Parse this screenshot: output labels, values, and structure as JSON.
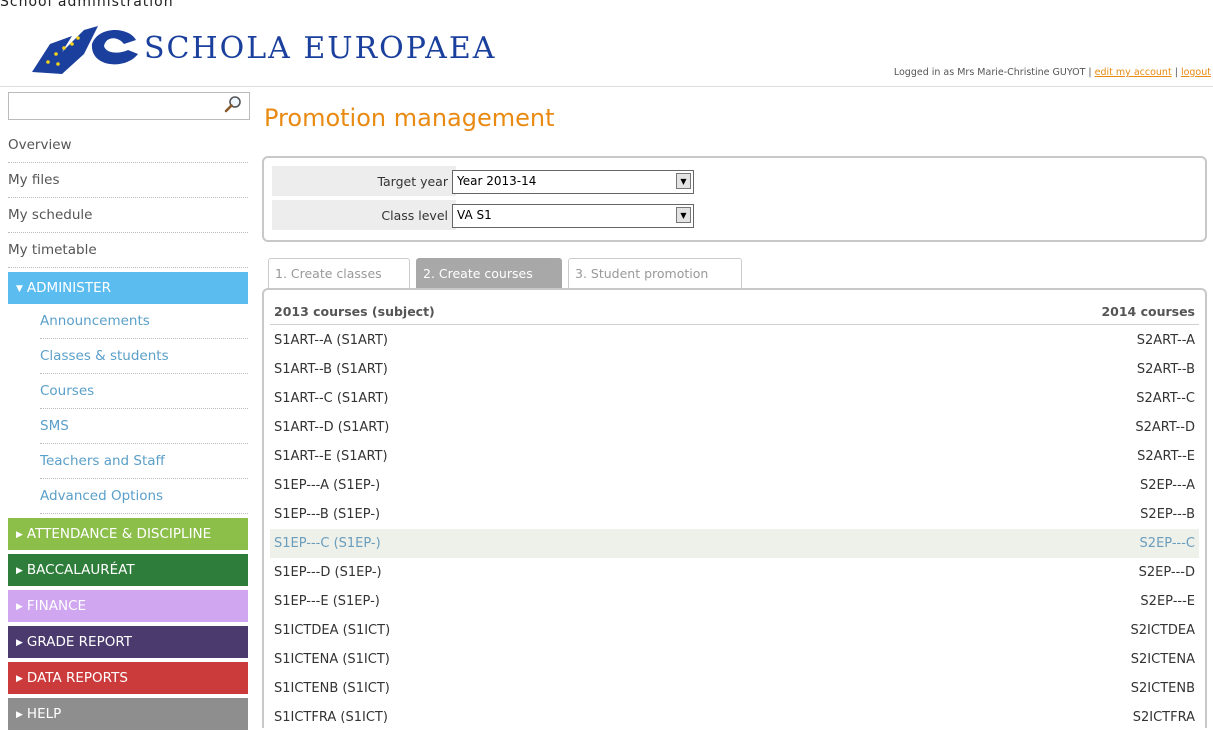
{
  "header": {
    "top_strip": "School administration",
    "logo_text": "SCHOLA EUROPAEA",
    "logged_in_text": "Logged in as Mrs Marie-Christine GUYOT |",
    "edit_account": "edit my account",
    "separator": "|",
    "logout": "logout"
  },
  "sidebar": {
    "search_placeholder": "",
    "nav": [
      "Overview",
      "My files",
      "My schedule",
      "My timetable"
    ],
    "sections": [
      {
        "label": "ADMINISTER",
        "color": "#5bbcf0",
        "expanded": true
      },
      {
        "label": "ATTENDANCE & DISCIPLINE",
        "color": "#8cbe4a"
      },
      {
        "label": "BACCALAURÉAT",
        "color": "#2e7d3a"
      },
      {
        "label": "FINANCE",
        "color": "#cfa6ef"
      },
      {
        "label": "GRADE REPORT",
        "color": "#4a3a6e"
      },
      {
        "label": "DATA REPORTS",
        "color": "#cc3b3b"
      },
      {
        "label": "HELP",
        "color": "#8e8e8e"
      }
    ],
    "administer_items": [
      "Announcements",
      "Classes & students",
      "Courses",
      "SMS",
      "Teachers and Staff",
      "Advanced Options"
    ]
  },
  "main": {
    "title": "Promotion management",
    "target_year_label": "Target year",
    "target_year_value": "Year 2013-14",
    "class_level_label": "Class level",
    "class_level_value": "VA S1",
    "tabs": [
      "1. Create classes",
      "2. Create courses",
      "3. Student promotion"
    ],
    "active_tab": 1,
    "table": {
      "col1": "2013 courses (subject)",
      "col2": "2014 courses",
      "rows": [
        [
          "S1ART--A (S1ART)",
          "S2ART--A"
        ],
        [
          "S1ART--B (S1ART)",
          "S2ART--B"
        ],
        [
          "S1ART--C (S1ART)",
          "S2ART--C"
        ],
        [
          "S1ART--D (S1ART)",
          "S2ART--D"
        ],
        [
          "S1ART--E (S1ART)",
          "S2ART--E"
        ],
        [
          "S1EP---A (S1EP-)",
          "S2EP---A"
        ],
        [
          "S1EP---B (S1EP-)",
          "S2EP---B"
        ],
        [
          "S1EP---C (S1EP-)",
          "S2EP---C"
        ],
        [
          "S1EP---D (S1EP-)",
          "S2EP---D"
        ],
        [
          "S1EP---E (S1EP-)",
          "S2EP---E"
        ],
        [
          "S1ICTDEA (S1ICT)",
          "S2ICTDEA"
        ],
        [
          "S1ICTENA (S1ICT)",
          "S2ICTENA"
        ],
        [
          "S1ICTENB (S1ICT)",
          "S2ICTENB"
        ],
        [
          "S1ICTFRA (S1ICT)",
          "S2ICTFRA"
        ]
      ],
      "highlighted_row": 7
    }
  }
}
